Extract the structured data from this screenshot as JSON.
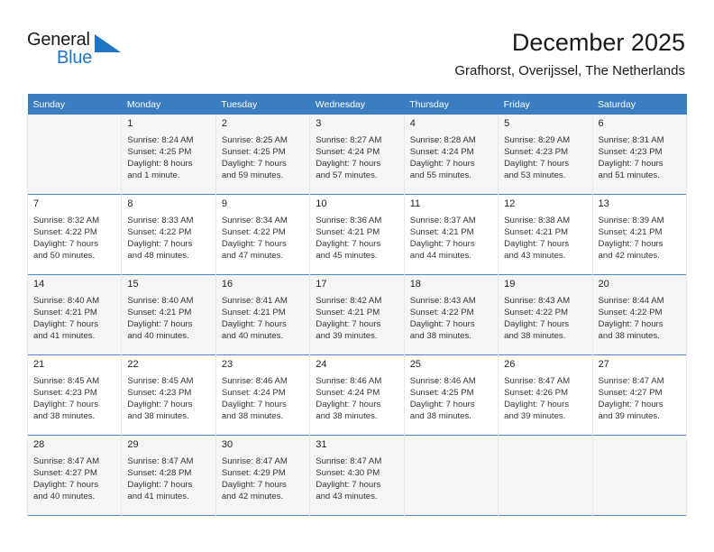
{
  "brand": {
    "name_part1": "General",
    "name_part2": "Blue",
    "logo_color": "#1f77c4"
  },
  "header": {
    "title": "December 2025",
    "subtitle": "Grafhorst, Overijssel, The Netherlands"
  },
  "theme": {
    "header_bg": "#3a7dc0",
    "row_divider": "#4f86c6",
    "shaded_row_bg": "#f5f5f5"
  },
  "calendar": {
    "weekday_headers": [
      "Sunday",
      "Monday",
      "Tuesday",
      "Wednesday",
      "Thursday",
      "Friday",
      "Saturday"
    ],
    "weeks": [
      {
        "shaded": true,
        "days": [
          {
            "num": "",
            "info": ""
          },
          {
            "num": "1",
            "info": "Sunrise: 8:24 AM\nSunset: 4:25 PM\nDaylight: 8 hours\nand 1 minute."
          },
          {
            "num": "2",
            "info": "Sunrise: 8:25 AM\nSunset: 4:25 PM\nDaylight: 7 hours\nand 59 minutes."
          },
          {
            "num": "3",
            "info": "Sunrise: 8:27 AM\nSunset: 4:24 PM\nDaylight: 7 hours\nand 57 minutes."
          },
          {
            "num": "4",
            "info": "Sunrise: 8:28 AM\nSunset: 4:24 PM\nDaylight: 7 hours\nand 55 minutes."
          },
          {
            "num": "5",
            "info": "Sunrise: 8:29 AM\nSunset: 4:23 PM\nDaylight: 7 hours\nand 53 minutes."
          },
          {
            "num": "6",
            "info": "Sunrise: 8:31 AM\nSunset: 4:23 PM\nDaylight: 7 hours\nand 51 minutes."
          }
        ]
      },
      {
        "shaded": false,
        "days": [
          {
            "num": "7",
            "info": "Sunrise: 8:32 AM\nSunset: 4:22 PM\nDaylight: 7 hours\nand 50 minutes."
          },
          {
            "num": "8",
            "info": "Sunrise: 8:33 AM\nSunset: 4:22 PM\nDaylight: 7 hours\nand 48 minutes."
          },
          {
            "num": "9",
            "info": "Sunrise: 8:34 AM\nSunset: 4:22 PM\nDaylight: 7 hours\nand 47 minutes."
          },
          {
            "num": "10",
            "info": "Sunrise: 8:36 AM\nSunset: 4:21 PM\nDaylight: 7 hours\nand 45 minutes."
          },
          {
            "num": "11",
            "info": "Sunrise: 8:37 AM\nSunset: 4:21 PM\nDaylight: 7 hours\nand 44 minutes."
          },
          {
            "num": "12",
            "info": "Sunrise: 8:38 AM\nSunset: 4:21 PM\nDaylight: 7 hours\nand 43 minutes."
          },
          {
            "num": "13",
            "info": "Sunrise: 8:39 AM\nSunset: 4:21 PM\nDaylight: 7 hours\nand 42 minutes."
          }
        ]
      },
      {
        "shaded": true,
        "days": [
          {
            "num": "14",
            "info": "Sunrise: 8:40 AM\nSunset: 4:21 PM\nDaylight: 7 hours\nand 41 minutes."
          },
          {
            "num": "15",
            "info": "Sunrise: 8:40 AM\nSunset: 4:21 PM\nDaylight: 7 hours\nand 40 minutes."
          },
          {
            "num": "16",
            "info": "Sunrise: 8:41 AM\nSunset: 4:21 PM\nDaylight: 7 hours\nand 40 minutes."
          },
          {
            "num": "17",
            "info": "Sunrise: 8:42 AM\nSunset: 4:21 PM\nDaylight: 7 hours\nand 39 minutes."
          },
          {
            "num": "18",
            "info": "Sunrise: 8:43 AM\nSunset: 4:22 PM\nDaylight: 7 hours\nand 38 minutes."
          },
          {
            "num": "19",
            "info": "Sunrise: 8:43 AM\nSunset: 4:22 PM\nDaylight: 7 hours\nand 38 minutes."
          },
          {
            "num": "20",
            "info": "Sunrise: 8:44 AM\nSunset: 4:22 PM\nDaylight: 7 hours\nand 38 minutes."
          }
        ]
      },
      {
        "shaded": false,
        "days": [
          {
            "num": "21",
            "info": "Sunrise: 8:45 AM\nSunset: 4:23 PM\nDaylight: 7 hours\nand 38 minutes."
          },
          {
            "num": "22",
            "info": "Sunrise: 8:45 AM\nSunset: 4:23 PM\nDaylight: 7 hours\nand 38 minutes."
          },
          {
            "num": "23",
            "info": "Sunrise: 8:46 AM\nSunset: 4:24 PM\nDaylight: 7 hours\nand 38 minutes."
          },
          {
            "num": "24",
            "info": "Sunrise: 8:46 AM\nSunset: 4:24 PM\nDaylight: 7 hours\nand 38 minutes."
          },
          {
            "num": "25",
            "info": "Sunrise: 8:46 AM\nSunset: 4:25 PM\nDaylight: 7 hours\nand 38 minutes."
          },
          {
            "num": "26",
            "info": "Sunrise: 8:47 AM\nSunset: 4:26 PM\nDaylight: 7 hours\nand 39 minutes."
          },
          {
            "num": "27",
            "info": "Sunrise: 8:47 AM\nSunset: 4:27 PM\nDaylight: 7 hours\nand 39 minutes."
          }
        ]
      },
      {
        "shaded": true,
        "days": [
          {
            "num": "28",
            "info": "Sunrise: 8:47 AM\nSunset: 4:27 PM\nDaylight: 7 hours\nand 40 minutes."
          },
          {
            "num": "29",
            "info": "Sunrise: 8:47 AM\nSunset: 4:28 PM\nDaylight: 7 hours\nand 41 minutes."
          },
          {
            "num": "30",
            "info": "Sunrise: 8:47 AM\nSunset: 4:29 PM\nDaylight: 7 hours\nand 42 minutes."
          },
          {
            "num": "31",
            "info": "Sunrise: 8:47 AM\nSunset: 4:30 PM\nDaylight: 7 hours\nand 43 minutes."
          },
          {
            "num": "",
            "info": ""
          },
          {
            "num": "",
            "info": ""
          },
          {
            "num": "",
            "info": ""
          }
        ]
      }
    ]
  }
}
